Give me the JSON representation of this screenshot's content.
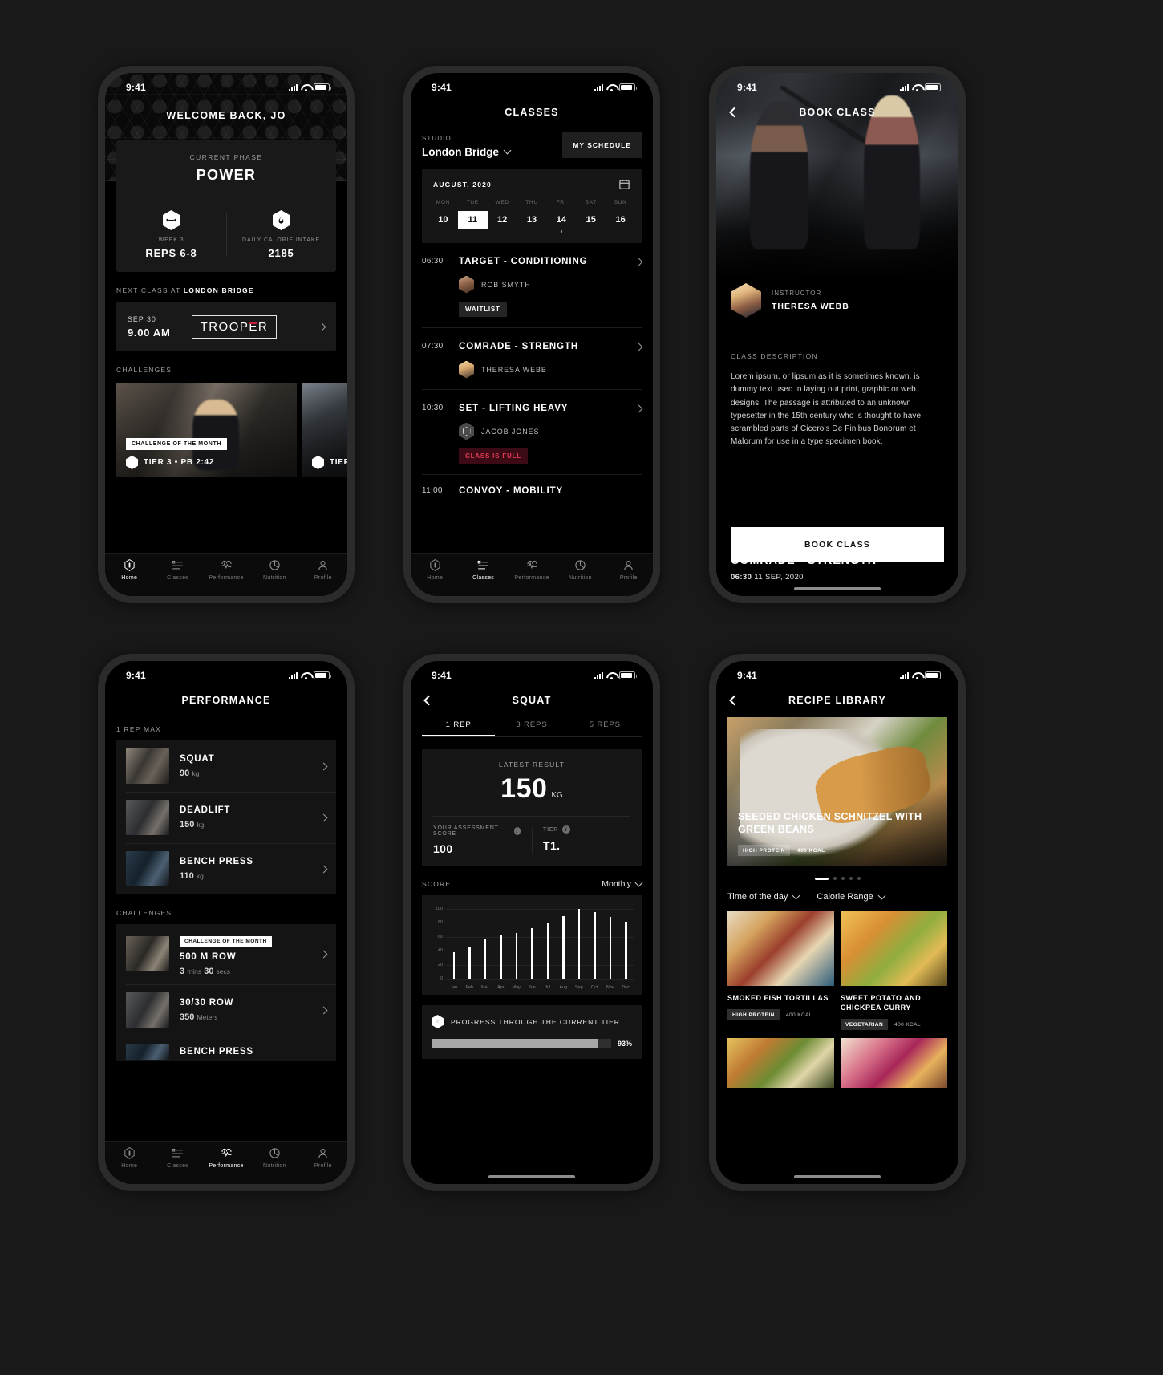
{
  "status_bar": {
    "time": "9:41"
  },
  "home": {
    "welcome": "WELCOME BACK, JO",
    "phase_label": "CURRENT PHASE",
    "phase_value": "POWER",
    "stats": [
      {
        "icon": "dumbbell-icon",
        "label": "WEEK 3",
        "value": "REPS 6-8"
      },
      {
        "icon": "flame-icon",
        "label": "DAILY CALORIE INTAKE",
        "value": "2185"
      }
    ],
    "next_class_prefix": "NEXT CLASS AT ",
    "next_class_studio": "LONDON BRIDGE",
    "next_class_date": "SEP 30",
    "next_class_time": "9.00 AM",
    "next_class_brand": "TROOPER",
    "challenges_label": "CHALLENGES",
    "challenge_badge": "CHALLENGE OF THE MONTH",
    "challenge_meta": "TIER 3 • PB 2:42",
    "challenge_meta_2": "TIER"
  },
  "tabs": [
    {
      "name": "home",
      "label": "Home"
    },
    {
      "name": "classes",
      "label": "Classes"
    },
    {
      "name": "performance",
      "label": "Performance"
    },
    {
      "name": "nutrition",
      "label": "Nutrition"
    },
    {
      "name": "profile",
      "label": "Profile"
    }
  ],
  "classes": {
    "title": "CLASSES",
    "studio_label": "STUDIO",
    "studio_name": "London Bridge",
    "my_schedule": "MY SCHEDULE",
    "calendar_month": "AUGUST, 2020",
    "days": [
      {
        "dow": "MON",
        "num": "10",
        "selected": false,
        "dot": false
      },
      {
        "dow": "TUE",
        "num": "11",
        "selected": true,
        "dot": false
      },
      {
        "dow": "WED",
        "num": "12",
        "selected": false,
        "dot": false
      },
      {
        "dow": "THU",
        "num": "13",
        "selected": false,
        "dot": false
      },
      {
        "dow": "FRI",
        "num": "14",
        "selected": false,
        "dot": true
      },
      {
        "dow": "SAT",
        "num": "15",
        "selected": false,
        "dot": false
      },
      {
        "dow": "SUN",
        "num": "16",
        "selected": false,
        "dot": false
      }
    ],
    "list": [
      {
        "time": "06:30",
        "name": "TARGET -  CONDITIONING",
        "instructor": "ROB SMYTH",
        "tag": "WAITLIST",
        "tag_type": "wait"
      },
      {
        "time": "07:30",
        "name": "COMRADE - STRENGTH",
        "instructor": "THERESA WEBB",
        "tag": "",
        "tag_type": ""
      },
      {
        "time": "10:30",
        "name": "SET - LIFTING HEAVY",
        "instructor": "JACOB JONES",
        "tag": "CLASS IS FULL",
        "tag_type": "full"
      },
      {
        "time": "11:00",
        "name": "CONVOY - MOBILITY",
        "instructor": "",
        "tag": "",
        "tag_type": ""
      }
    ]
  },
  "book_class": {
    "title": "BOOK CLASS",
    "hero_title": "COMRADE - STRENGTH",
    "hero_time": "06:30",
    "hero_date": "11 SEP, 2020",
    "instructor_label": "INSTRUCTOR",
    "instructor_name": "THERESA WEBB",
    "description_label": "CLASS DESCRIPTION",
    "description": "Lorem ipsum, or lipsum as it is sometimes known, is dummy text used in laying out print, graphic or web designs. The passage is attributed to an unknown typesetter in the 15th century who is thought to have scrambled parts of Cicero's De Finibus Bonorum et Malorum for use in a type specimen book.",
    "button": "BOOK CLASS"
  },
  "performance": {
    "title": "PERFORMANCE",
    "section_one_rep_max": "1 REP MAX",
    "lifts": [
      {
        "name": "SQUAT",
        "value": "90",
        "unit": "kg"
      },
      {
        "name": "DEADLIFT",
        "value": "150",
        "unit": "kg"
      },
      {
        "name": "BENCH PRESS",
        "value": "110",
        "unit": "kg"
      }
    ],
    "section_challenges": "CHALLENGES",
    "challenges": [
      {
        "badge": "CHALLENGE OF THE MONTH",
        "name": "500 M ROW",
        "value": "3",
        "unit": "mins",
        "value2": "30",
        "unit2": "secs"
      },
      {
        "badge": "",
        "name": "30/30 ROW",
        "value": "350",
        "unit": "Meters",
        "value2": "",
        "unit2": ""
      },
      {
        "badge": "",
        "name": "BENCH PRESS",
        "value": "",
        "unit": "",
        "value2": "",
        "unit2": ""
      }
    ]
  },
  "squat": {
    "title": "SQUAT",
    "segments": [
      {
        "label": "1 REP",
        "active": true
      },
      {
        "label": "3 REPS",
        "active": false
      },
      {
        "label": "5 REPS",
        "active": false
      }
    ],
    "latest_label": "LATEST RESULT",
    "latest_value": "150",
    "latest_unit": "KG",
    "assessment_label": "YOUR ASSESSMENT SCORE",
    "assessment_value": "100",
    "tier_label": "TIER",
    "tier_value": "T1.",
    "score_label": "SCORE",
    "score_period": "Monthly",
    "progress_label": "PROGRESS THROUGH THE CURRENT TIER",
    "progress_pct": "93%",
    "progress_value": 93
  },
  "chart_data": {
    "type": "bar",
    "title": "SCORE",
    "categories": [
      "Jan",
      "Feb",
      "Mar",
      "Apr",
      "May",
      "Jun",
      "Jul",
      "Aug",
      "Sep",
      "Oct",
      "Nov",
      "Dec"
    ],
    "values": [
      38,
      46,
      57,
      62,
      66,
      72,
      80,
      90,
      100,
      95,
      88,
      82
    ],
    "yticks": [
      0,
      20,
      40,
      60,
      80,
      100
    ],
    "ylim": [
      0,
      108
    ],
    "xlabel": "",
    "ylabel": "",
    "legend": "none",
    "grid": true
  },
  "recipes": {
    "title": "RECIPE LIBRARY",
    "hero_title": "SEEDED CHICKEN SCHNITZEL WITH GREEN BEANS",
    "hero_tag": "HIGH PROTEIN",
    "hero_kcal": "400 KCAL",
    "dots_total": 5,
    "dots_active": 1,
    "filters": [
      {
        "label": "Time of the day"
      },
      {
        "label": "Calorie Range"
      }
    ],
    "cards": [
      {
        "name": "SMOKED FISH TORTILLAS",
        "tag": "HIGH PROTEIN",
        "kcal": "400 KCAL"
      },
      {
        "name": "SWEET POTATO AND CHICKPEA CURRY",
        "tag": "VEGETARIAN",
        "kcal": "400 KCAL"
      },
      {
        "name": "",
        "tag": "",
        "kcal": ""
      },
      {
        "name": "",
        "tag": "",
        "kcal": ""
      }
    ]
  }
}
